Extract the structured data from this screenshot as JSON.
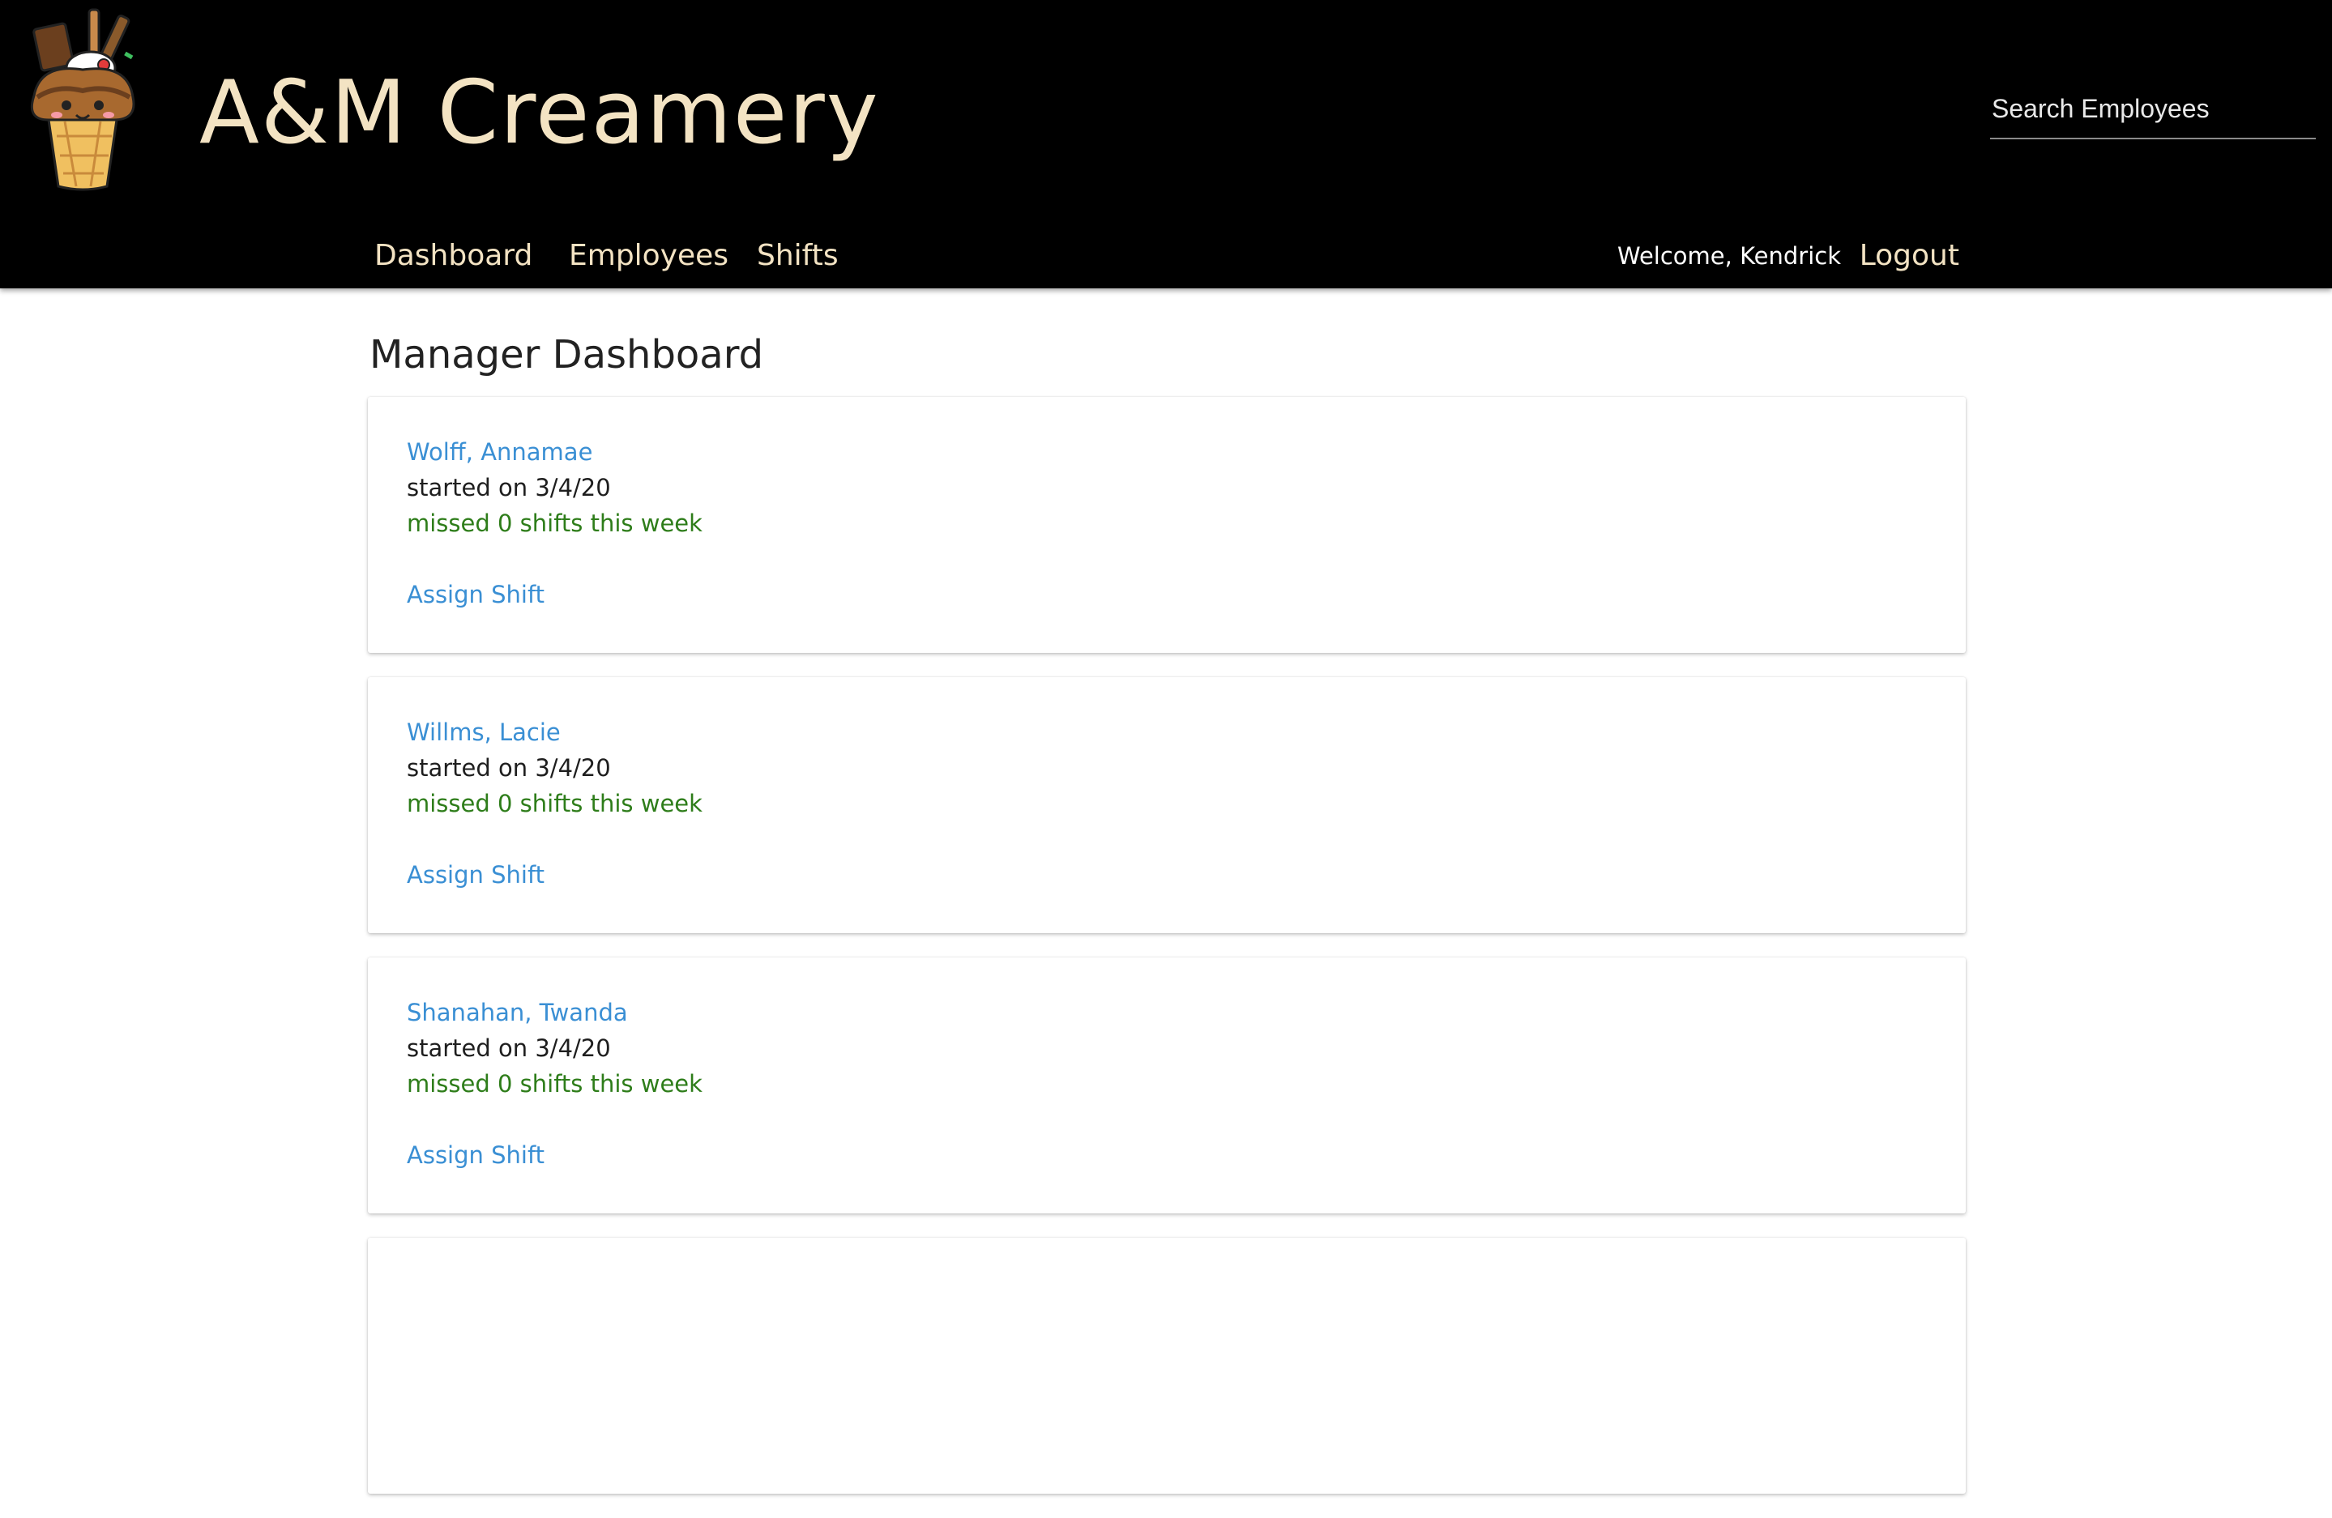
{
  "header": {
    "brand": "A&M Creamery",
    "logo_icon": "ice-cream-sundae-logo",
    "search_placeholder": "Search Employees",
    "nav": [
      {
        "label": "Dashboard"
      },
      {
        "label": "Employees"
      },
      {
        "label": "Shifts"
      }
    ],
    "welcome": "Welcome, Kendrick",
    "logout": "Logout"
  },
  "main": {
    "title": "Manager Dashboard",
    "cards": [
      {
        "name": "Wolff, Annamae",
        "started": "started on 3/4/20",
        "missed": "missed 0 shifts this week",
        "action": "Assign Shift"
      },
      {
        "name": "Willms, Lacie",
        "started": "started on 3/4/20",
        "missed": "missed 0 shifts this week",
        "action": "Assign Shift"
      },
      {
        "name": "Shanahan, Twanda",
        "started": "started on 3/4/20",
        "missed": "missed 0 shifts this week",
        "action": "Assign Shift"
      }
    ]
  },
  "colors": {
    "header_bg": "#000000",
    "accent_cream": "#f3e3c3",
    "link_blue": "#3a8fd4",
    "success_green": "#2e7d1a"
  }
}
